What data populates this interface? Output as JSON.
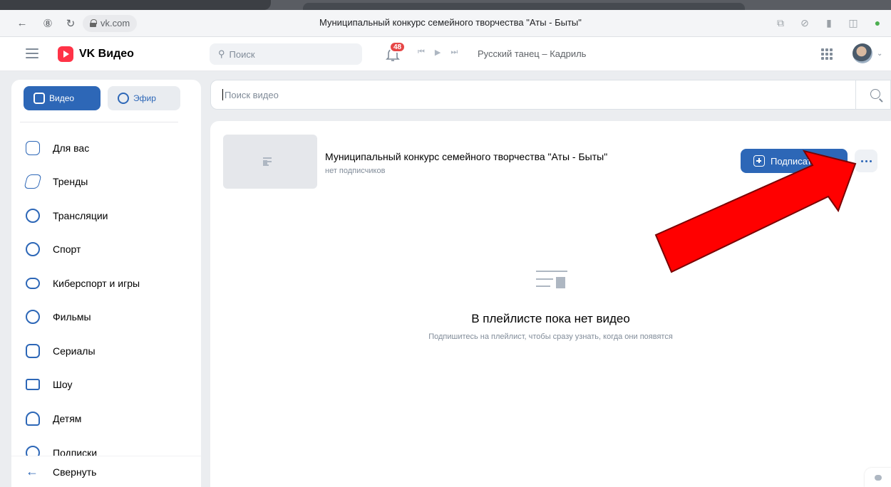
{
  "browser": {
    "url": "vk.com",
    "page_title": "Муниципальный конкурс семейного творчества \"Аты - Быты\""
  },
  "header": {
    "logo_text": "VK Видео",
    "search_placeholder": "Поиск",
    "notification_count": "48",
    "now_playing": "Русский танец – Кадриль"
  },
  "sidebar": {
    "segments": [
      {
        "label": "Видео"
      },
      {
        "label": "Эфир"
      }
    ],
    "items": [
      {
        "label": "Для вас"
      },
      {
        "label": "Тренды"
      },
      {
        "label": "Трансляции"
      },
      {
        "label": "Спорт"
      },
      {
        "label": "Киберспорт и игры"
      },
      {
        "label": "Фильмы"
      },
      {
        "label": "Сериалы"
      },
      {
        "label": "Шоу"
      },
      {
        "label": "Детям"
      },
      {
        "label": "Подписки"
      }
    ],
    "collapse_label": "Свернуть"
  },
  "video_search": {
    "placeholder": "Поиск видео"
  },
  "playlist": {
    "title": "Муниципальный конкурс семейного творчества \"Аты - Быты\"",
    "subscribers": "нет подписчиков",
    "subscribe_label": "Подписаться",
    "empty_title": "В плейлисте пока нет видео",
    "empty_subtitle": "Подпишитесь на плейлист, чтобы сразу узнать, когда они появятся"
  },
  "colors": {
    "accent": "#2d67b7",
    "arrow": "#ff0000"
  }
}
